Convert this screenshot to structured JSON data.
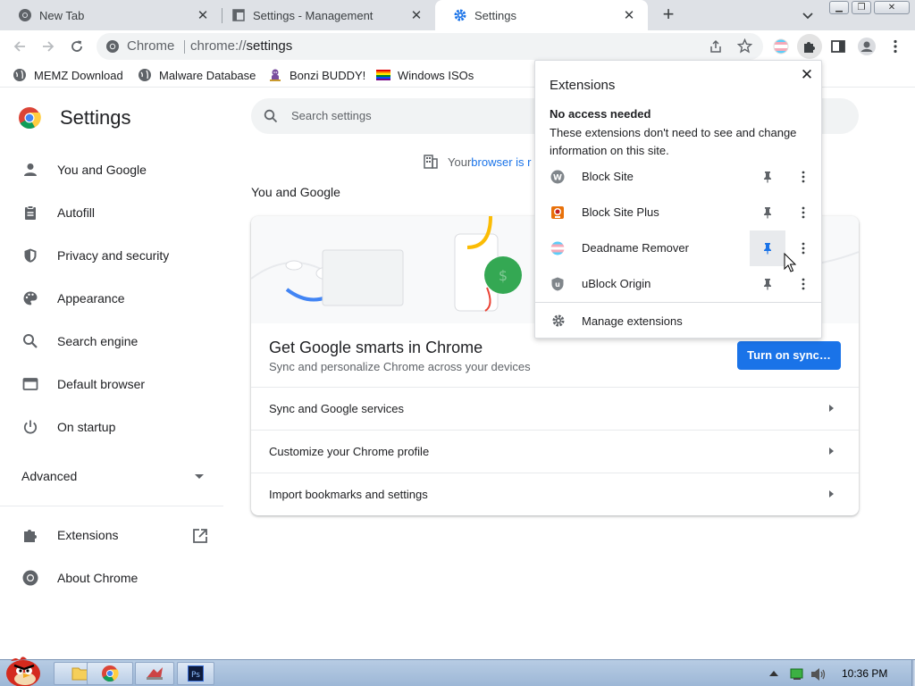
{
  "tabs": [
    {
      "title": "New Tab",
      "icon": "chrome-icon",
      "active": false
    },
    {
      "title": "Settings - Management",
      "icon": "page-icon",
      "active": false
    },
    {
      "title": "Settings",
      "icon": "gear-icon",
      "active": true
    }
  ],
  "toolbar": {
    "omnibox_chip": "Chrome",
    "url_scheme": "chrome://",
    "url_path": "settings"
  },
  "bookmarks": [
    {
      "label": "MEMZ Download",
      "icon": "globe-icon"
    },
    {
      "label": "Malware Database",
      "icon": "globe-icon"
    },
    {
      "label": "Bonzi BUDDY!",
      "icon": "bonzi-icon"
    },
    {
      "label": "Windows ISOs",
      "icon": "rainbow-flag-icon"
    }
  ],
  "settings": {
    "title": "Settings",
    "search_placeholder": "Search settings",
    "managed_notice_prefix": "Your ",
    "managed_notice_link": "browser is r",
    "nav": [
      {
        "label": "You and Google",
        "icon": "person-icon"
      },
      {
        "label": "Autofill",
        "icon": "clipboard-icon"
      },
      {
        "label": "Privacy and security",
        "icon": "shield-icon"
      },
      {
        "label": "Appearance",
        "icon": "palette-icon"
      },
      {
        "label": "Search engine",
        "icon": "search-icon"
      },
      {
        "label": "Default browser",
        "icon": "browser-icon"
      },
      {
        "label": "On startup",
        "icon": "power-icon"
      }
    ],
    "advanced_label": "Advanced",
    "nav_bottom": [
      {
        "label": "Extensions",
        "icon": "puzzle-icon"
      },
      {
        "label": "About Chrome",
        "icon": "chrome-icon"
      }
    ],
    "section_title": "You and Google",
    "promo_title": "Get Google smarts in Chrome",
    "promo_subtitle": "Sync and personalize Chrome across your devices",
    "sync_button": "Turn on sync…",
    "rows": [
      "Sync and Google services",
      "Customize your Chrome profile",
      "Import bookmarks and settings"
    ]
  },
  "extensions_popup": {
    "title": "Extensions",
    "section_title": "No access needed",
    "section_desc": "These extensions don't need to see and change information on this site.",
    "items": [
      {
        "name": "Block Site",
        "icon": "block-site-icon",
        "pinned": false
      },
      {
        "name": "Block Site Plus",
        "icon": "block-site-plus-icon",
        "pinned": false
      },
      {
        "name": "Deadname Remover",
        "icon": "trans-flag-icon",
        "pinned": true
      },
      {
        "name": "uBlock Origin",
        "icon": "ublock-icon",
        "pinned": false
      }
    ],
    "manage_label": "Manage extensions"
  },
  "taskbar": {
    "clock": "10:36 PM"
  },
  "colors": {
    "accent": "#1a73e8",
    "tabstrip": "#dee1e6",
    "taskbar": "#a9c0dd"
  }
}
